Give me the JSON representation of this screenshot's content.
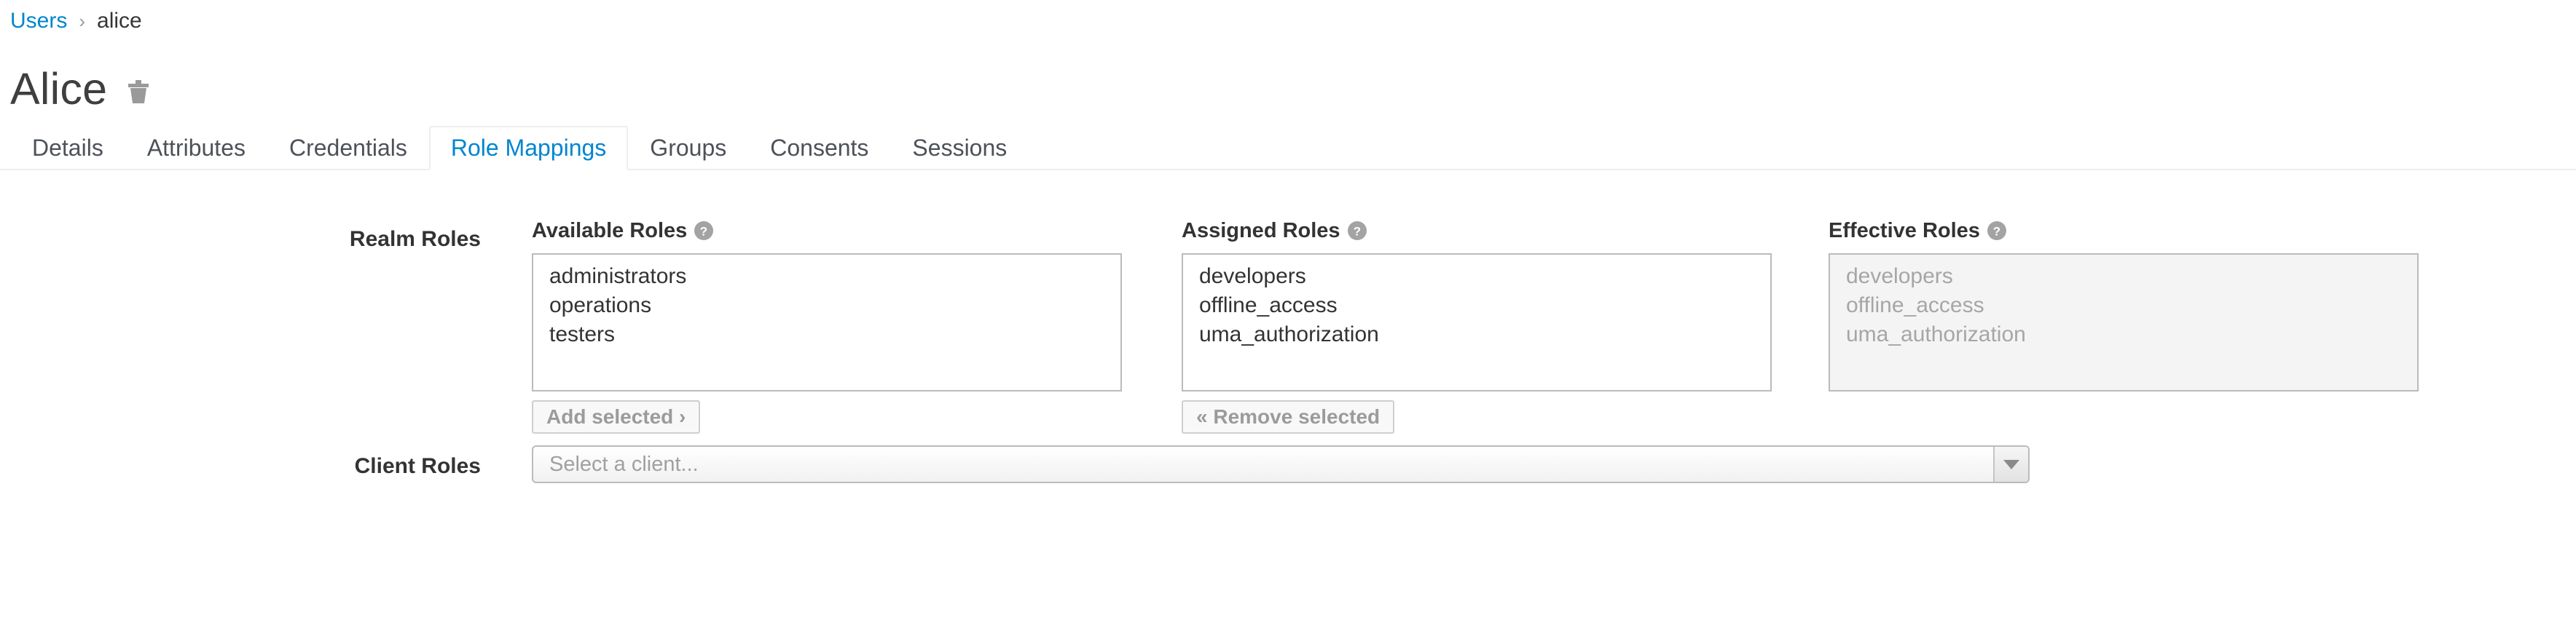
{
  "breadcrumb": {
    "parent": "Users",
    "separator": "›",
    "current": "alice"
  },
  "header": {
    "title": "Alice",
    "delete_icon": "trash-icon"
  },
  "tabs": [
    {
      "label": "Details",
      "active": false
    },
    {
      "label": "Attributes",
      "active": false
    },
    {
      "label": "Credentials",
      "active": false
    },
    {
      "label": "Role Mappings",
      "active": true
    },
    {
      "label": "Groups",
      "active": false
    },
    {
      "label": "Consents",
      "active": false
    },
    {
      "label": "Sessions",
      "active": false
    }
  ],
  "realm_roles": {
    "row_label": "Realm Roles",
    "available": {
      "label": "Available Roles",
      "help_icon": "help-circle-icon",
      "options": [
        "administrators",
        "operations",
        "testers"
      ],
      "button": "Add selected ›"
    },
    "assigned": {
      "label": "Assigned Roles",
      "help_icon": "help-circle-icon",
      "options": [
        "developers",
        "offline_access",
        "uma_authorization"
      ],
      "button": "« Remove selected"
    },
    "effective": {
      "label": "Effective Roles",
      "help_icon": "help-circle-icon",
      "options": [
        "developers",
        "offline_access",
        "uma_authorization"
      ],
      "disabled": true
    }
  },
  "client_roles": {
    "row_label": "Client Roles",
    "select_placeholder": "Select a client...",
    "select_value": "",
    "caret_icon": "chevron-down-icon"
  },
  "colors": {
    "link": "#0085cf",
    "active_tab": "#0085cf",
    "text": "#333333",
    "muted": "#a0a0a0",
    "border": "#bbbbbb",
    "disabled_bg": "#f4f4f4"
  }
}
